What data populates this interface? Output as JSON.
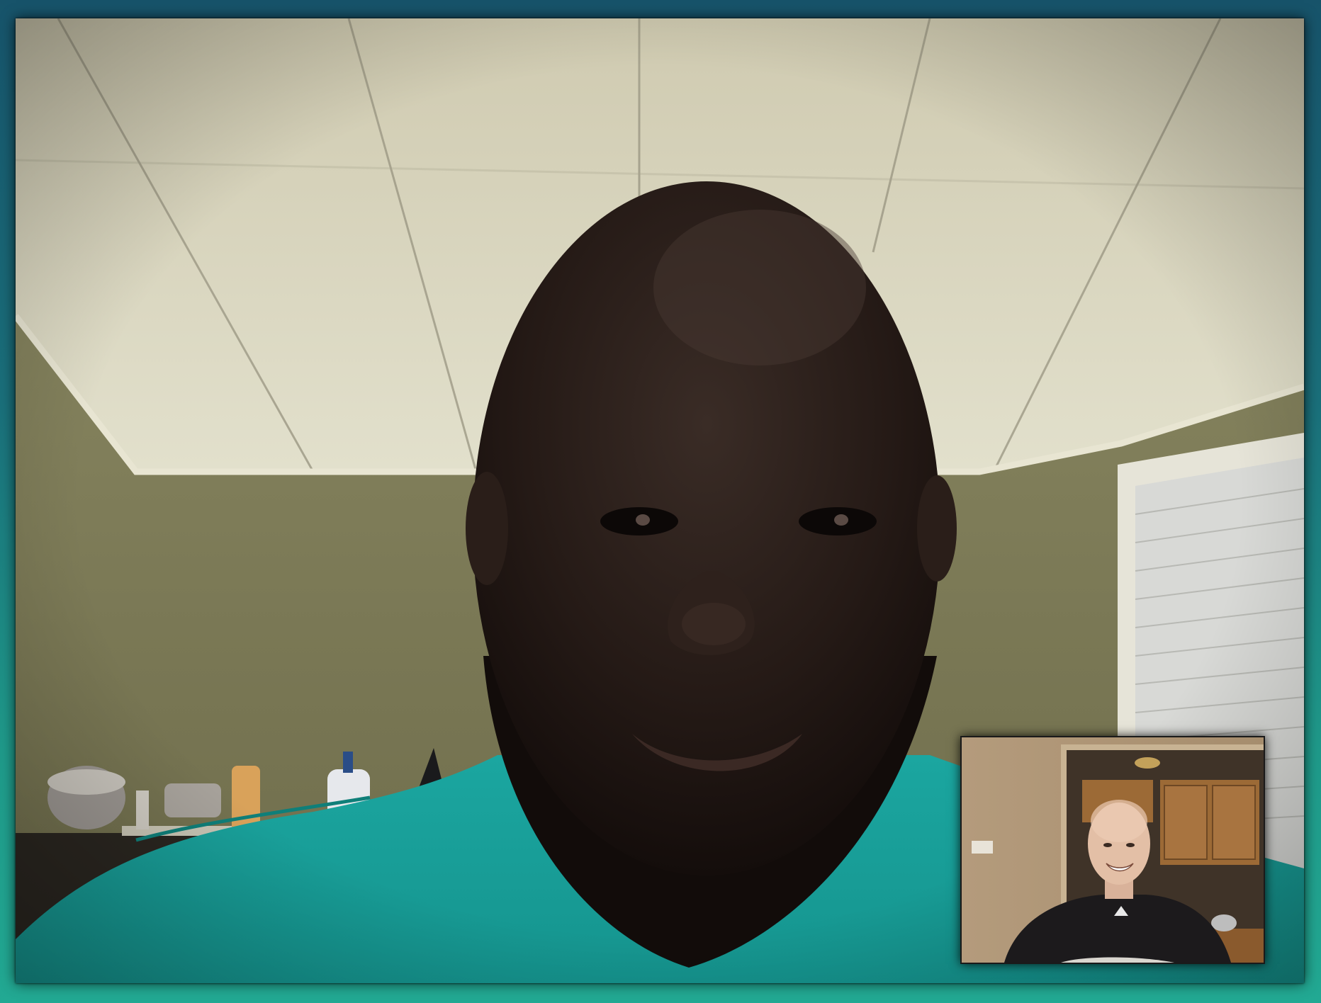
{
  "app": {
    "kind": "video-call"
  },
  "colors": {
    "frame_top": "#17536a",
    "frame_bottom": "#22a993",
    "ceiling": "#d6d3ba",
    "wall": "#8c8a62",
    "shirt": "#1aa6a0",
    "self_view_wall": "#b39a7a"
  },
  "icons": {
    "remote": "remote-participant-video",
    "self": "self-view-video"
  }
}
